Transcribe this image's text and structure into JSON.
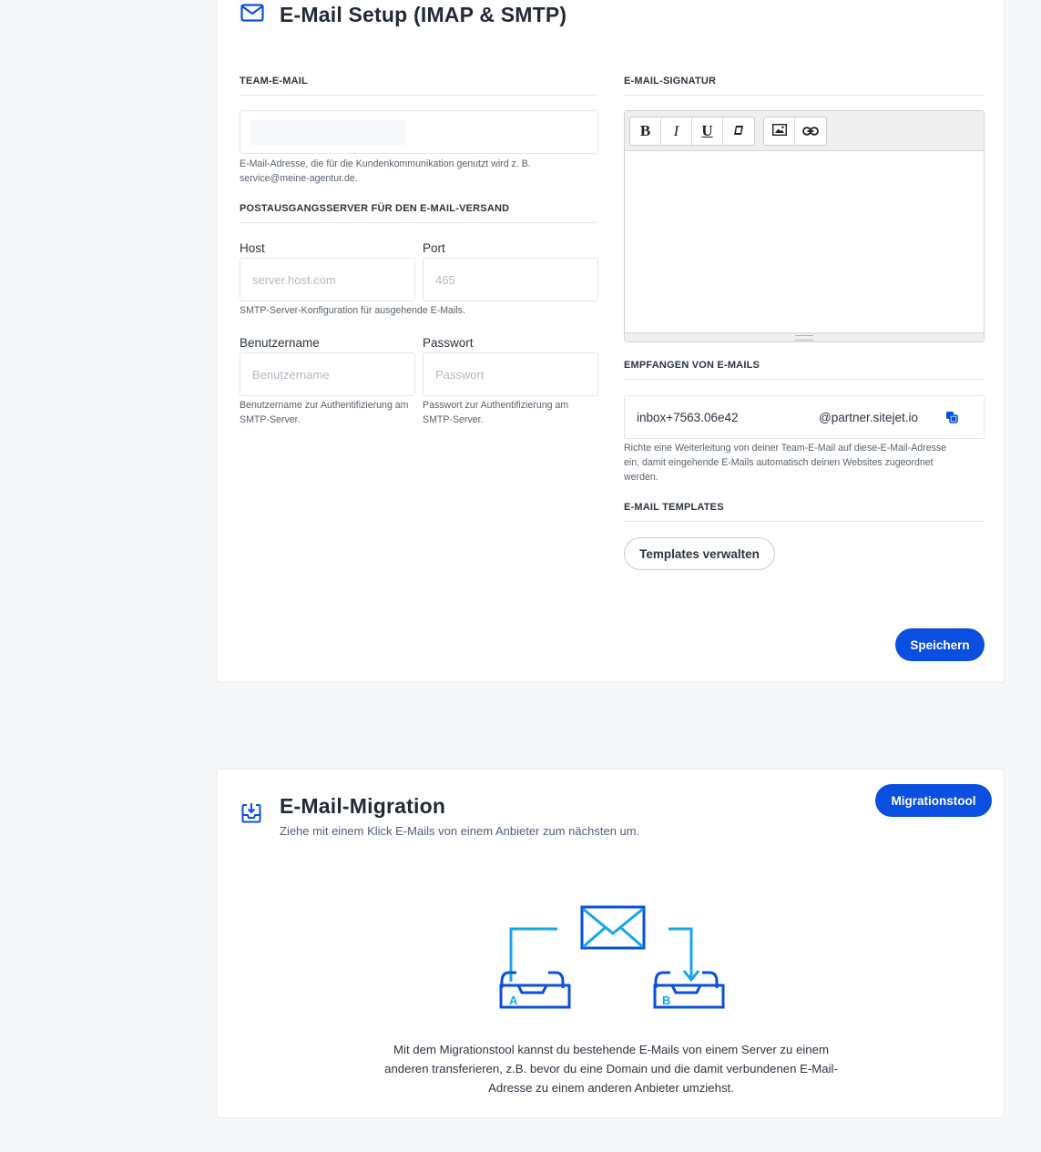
{
  "colors": {
    "accent": "#0a4fe0",
    "illustration_light": "#16a6e8",
    "illustration_dark": "#0a4fe0"
  },
  "email_setup": {
    "icon": "envelope-icon",
    "title": "E-Mail Setup (IMAP & SMTP)",
    "team_email": {
      "section_label": "TEAM-E-MAIL",
      "value": "",
      "help": "E-Mail-Adresse, die für die Kundenkommunikation genutzt wird z. B. service@meine-agentur.de."
    },
    "smtp": {
      "section_label": "POSTAUSGANGSSERVER FÜR DEN E-MAIL-VERSAND",
      "host_label": "Host",
      "host_placeholder": "server.host.com",
      "port_label": "Port",
      "port_placeholder": "465",
      "config_help": "SMTP-Server-Konfiguration für ausgehende E-Mails.",
      "username_label": "Benutzername",
      "username_placeholder": "Benutzername",
      "username_help": "Benutzername zur Authentifizierung am SMTP-Server.",
      "password_label": "Passwort",
      "password_placeholder": "Passwort",
      "password_help": "Passwort zur Authentifizierung am SMTP-Server."
    },
    "signature": {
      "section_label": "E-MAIL-SIGNATUR",
      "toolbar": [
        {
          "label": "B",
          "icon": "bold-icon"
        },
        {
          "label": "I",
          "icon": "italic-icon"
        },
        {
          "label": "U",
          "icon": "underline-icon"
        },
        {
          "label": "",
          "icon": "eraser-icon"
        },
        {
          "label": "",
          "icon": "image-icon"
        },
        {
          "label": "",
          "icon": "link-icon"
        }
      ]
    },
    "receive": {
      "section_label": "EMPFANGEN VON E-MAILS",
      "address_prefix": "inbox+7563.06e42",
      "address_suffix": "@partner.sitejet.io",
      "copy_icon": "copy-icon",
      "help": "Richte eine Weiterleitung von deiner Team-E-Mail auf diese-E-Mail-Adresse ein, damit eingehende E-Mails automatisch deinen Websites zugeordnet werden."
    },
    "templates": {
      "section_label": "E-MAIL TEMPLATES",
      "button_label": "Templates verwalten"
    },
    "save_label": "Speichern"
  },
  "migration": {
    "icon": "inbox-download-icon",
    "title": "E-Mail-Migration",
    "subtitle": "Ziehe mit einem Klick E-Mails von einem Anbieter zum nächsten um.",
    "button_label": "Migrationstool",
    "illustration": {
      "left_tray_letter": "A",
      "right_tray_letter": "B"
    },
    "description": "Mit dem Migrationstool kannst du bestehende E-Mails von einem Server zu einem anderen transferieren, z.B. bevor du eine Domain und die damit verbundenen E-Mail-Adresse zu einem anderen Anbieter umziehst."
  }
}
